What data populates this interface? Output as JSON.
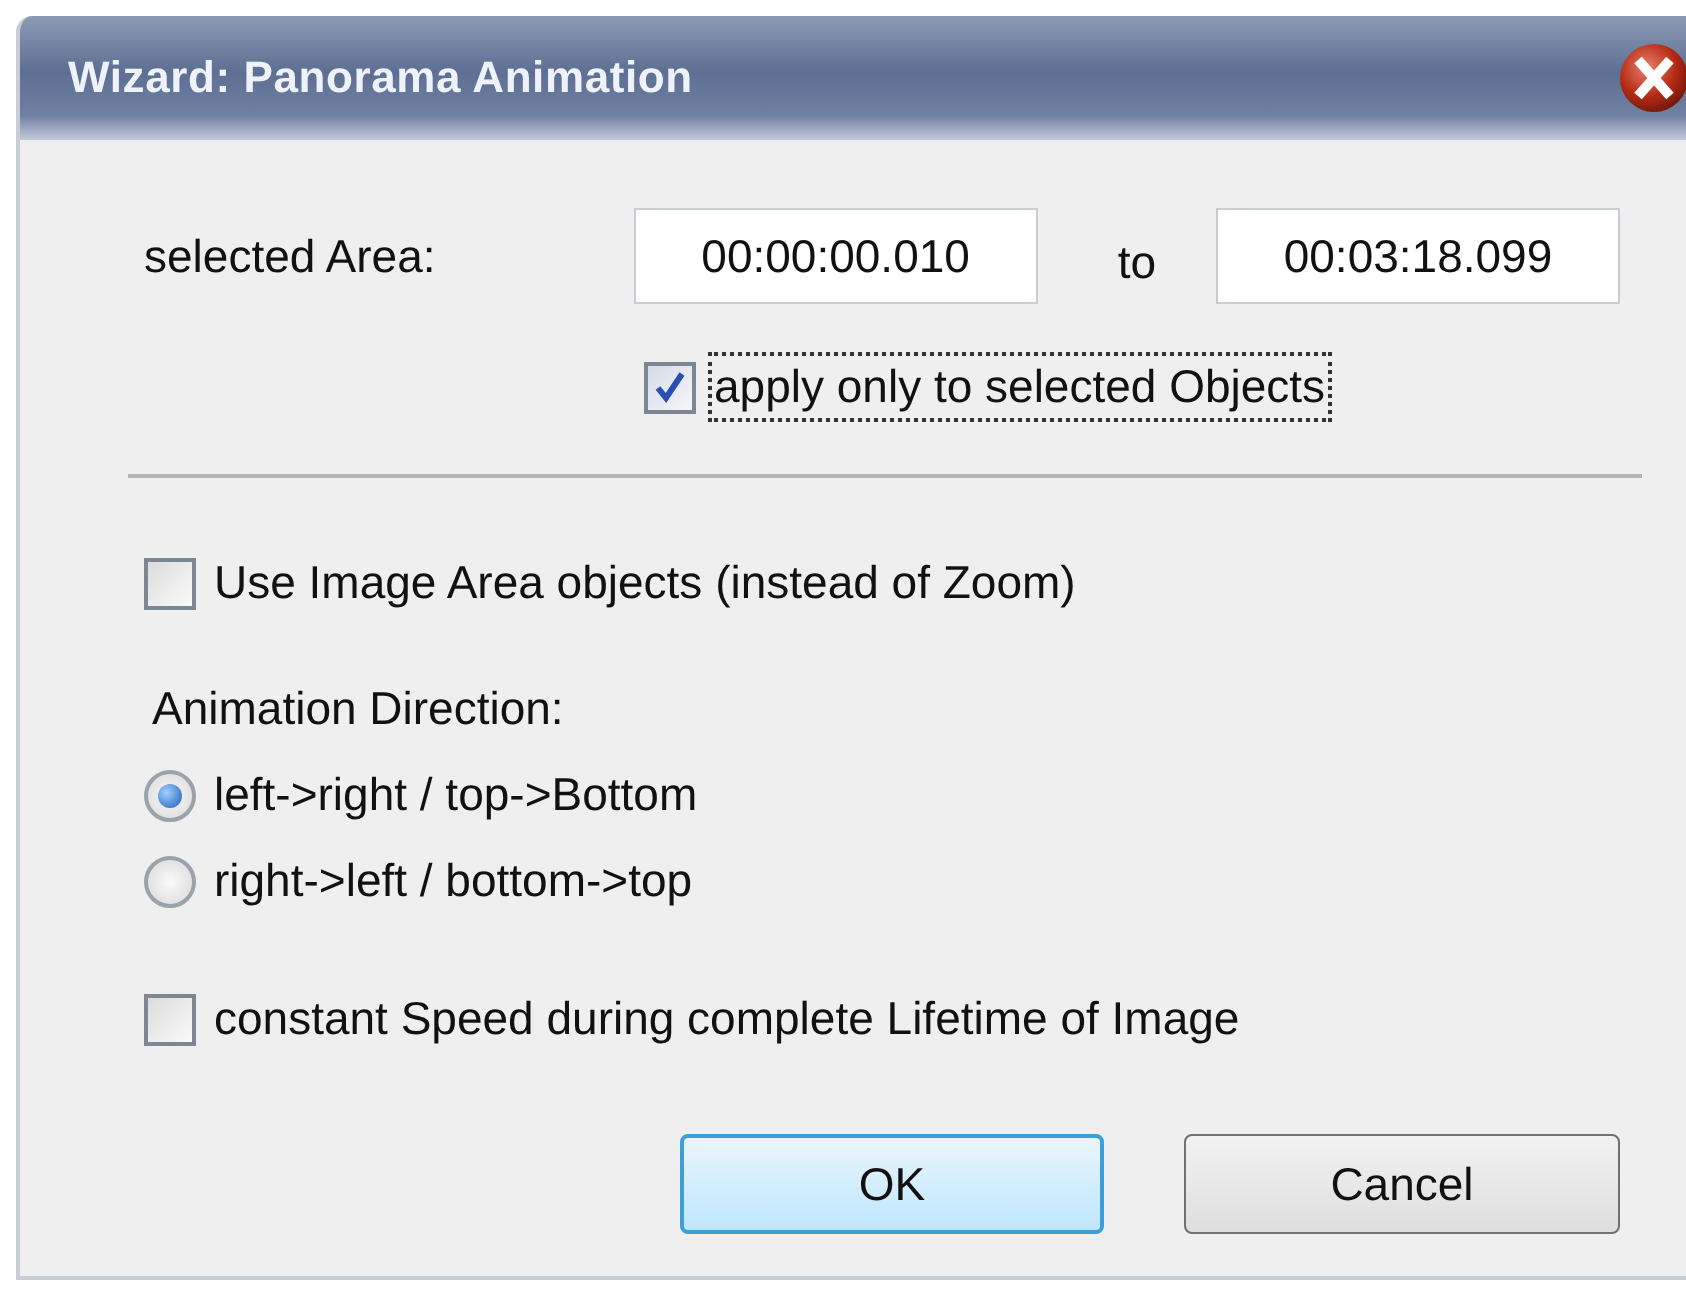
{
  "window": {
    "title": "Wizard: Panorama Animation"
  },
  "range": {
    "label": "selected Area:",
    "from": "00:00:00.010",
    "separator": "to",
    "to": "00:03:18.099"
  },
  "apply_selected": {
    "label": "apply only to selected Objects",
    "checked": true,
    "focused": true
  },
  "use_image_area": {
    "label": "Use Image Area objects (instead of Zoom)",
    "checked": false
  },
  "direction": {
    "label": "Animation Direction:",
    "options": [
      {
        "label": "left->right / top->Bottom",
        "selected": true
      },
      {
        "label": "right->left / bottom->top",
        "selected": false
      }
    ]
  },
  "constant_speed": {
    "label": "constant Speed during complete Lifetime of Image",
    "checked": false
  },
  "buttons": [
    {
      "label": "OK",
      "default": true
    },
    {
      "label": "Cancel",
      "default": false
    }
  ]
}
